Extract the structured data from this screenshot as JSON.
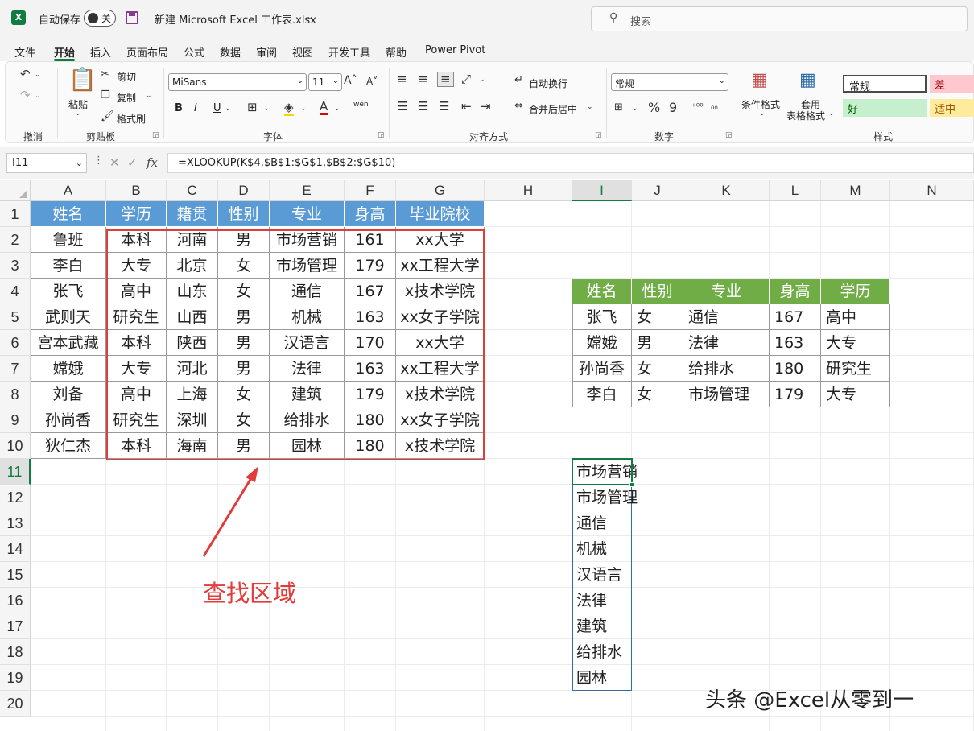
{
  "titlebar": {
    "logo": "X",
    "autosave_label": "自动保存",
    "autosave_state": "关",
    "doc_title": "新建 Microsoft Excel 工作表.xlsx",
    "search_placeholder": "搜索"
  },
  "tabs": [
    "文件",
    "开始",
    "插入",
    "页面布局",
    "公式",
    "数据",
    "审阅",
    "视图",
    "开发工具",
    "帮助",
    "Power Pivot"
  ],
  "active_tab": "开始",
  "ribbon": {
    "undo_group": "撤消",
    "clipboard": {
      "group": "剪贴板",
      "paste": "粘贴",
      "cut": "剪切",
      "copy": "复制",
      "format_painter": "格式刷"
    },
    "font": {
      "group": "字体",
      "name": "MiSans",
      "size": "11",
      "bold": "B",
      "italic": "I",
      "underline": "U",
      "phonetic": "wén"
    },
    "alignment": {
      "group": "对齐方式",
      "wrap": "自动换行",
      "merge": "合并后居中"
    },
    "number": {
      "group": "数字",
      "format": "常规"
    },
    "styles": {
      "group": "样式",
      "cond_format": "条件格式",
      "table_format_1": "套用",
      "table_format_2": "表格格式",
      "normal": "常规",
      "bad": "差",
      "good": "好",
      "neutral": "适中"
    }
  },
  "formula_bar": {
    "name_box": "I11",
    "fx": "fx",
    "formula": "=XLOOKUP(K$4,$B$1:$G$1,$B$2:$G$10)"
  },
  "columns": [
    "A",
    "B",
    "C",
    "D",
    "E",
    "F",
    "G",
    "H",
    "I",
    "J",
    "K",
    "L",
    "M",
    "N"
  ],
  "rows": [
    "1",
    "2",
    "3",
    "4",
    "5",
    "6",
    "7",
    "8",
    "9",
    "10",
    "11",
    "12",
    "13",
    "14",
    "15",
    "16",
    "17",
    "18",
    "19",
    "20"
  ],
  "main_table": {
    "headers": [
      "姓名",
      "学历",
      "籍贯",
      "性别",
      "专业",
      "身高",
      "毕业院校"
    ],
    "rows": [
      [
        "鲁班",
        "本科",
        "河南",
        "男",
        "市场营销",
        "161",
        "xx大学"
      ],
      [
        "李白",
        "大专",
        "北京",
        "女",
        "市场管理",
        "179",
        "xx工程大学"
      ],
      [
        "张飞",
        "高中",
        "山东",
        "女",
        "通信",
        "167",
        "x技术学院"
      ],
      [
        "武则天",
        "研究生",
        "山西",
        "男",
        "机械",
        "163",
        "xx女子学院"
      ],
      [
        "宫本武藏",
        "本科",
        "陕西",
        "男",
        "汉语言",
        "170",
        "xx大学"
      ],
      [
        "嫦娥",
        "大专",
        "河北",
        "男",
        "法律",
        "163",
        "xx工程大学"
      ],
      [
        "刘备",
        "高中",
        "上海",
        "女",
        "建筑",
        "179",
        "x技术学院"
      ],
      [
        "孙尚香",
        "研究生",
        "深圳",
        "女",
        "给排水",
        "180",
        "xx女子学院"
      ],
      [
        "狄仁杰",
        "本科",
        "海南",
        "男",
        "园林",
        "180",
        "x技术学院"
      ]
    ]
  },
  "lookup_table": {
    "headers": [
      "姓名",
      "性别",
      "专业",
      "身高",
      "学历"
    ],
    "rows": [
      [
        "张飞",
        "女",
        "通信",
        "167",
        "高中"
      ],
      [
        "嫦娥",
        "男",
        "法律",
        "163",
        "大专"
      ],
      [
        "孙尚香",
        "女",
        "给排水",
        "180",
        "研究生"
      ],
      [
        "李白",
        "女",
        "市场管理",
        "179",
        "大专"
      ]
    ]
  },
  "spill_list": [
    "市场营销",
    "市场管理",
    "通信",
    "机械",
    "汉语言",
    "法律",
    "建筑",
    "给排水",
    "园林"
  ],
  "annotation": "查找区域",
  "watermark": "头条 @Excel从零到一",
  "colors": {
    "accent": "#107c41",
    "header_blue": "#5b9bd5",
    "header_green": "#70ad47",
    "highlight_red": "#e03c3c"
  }
}
